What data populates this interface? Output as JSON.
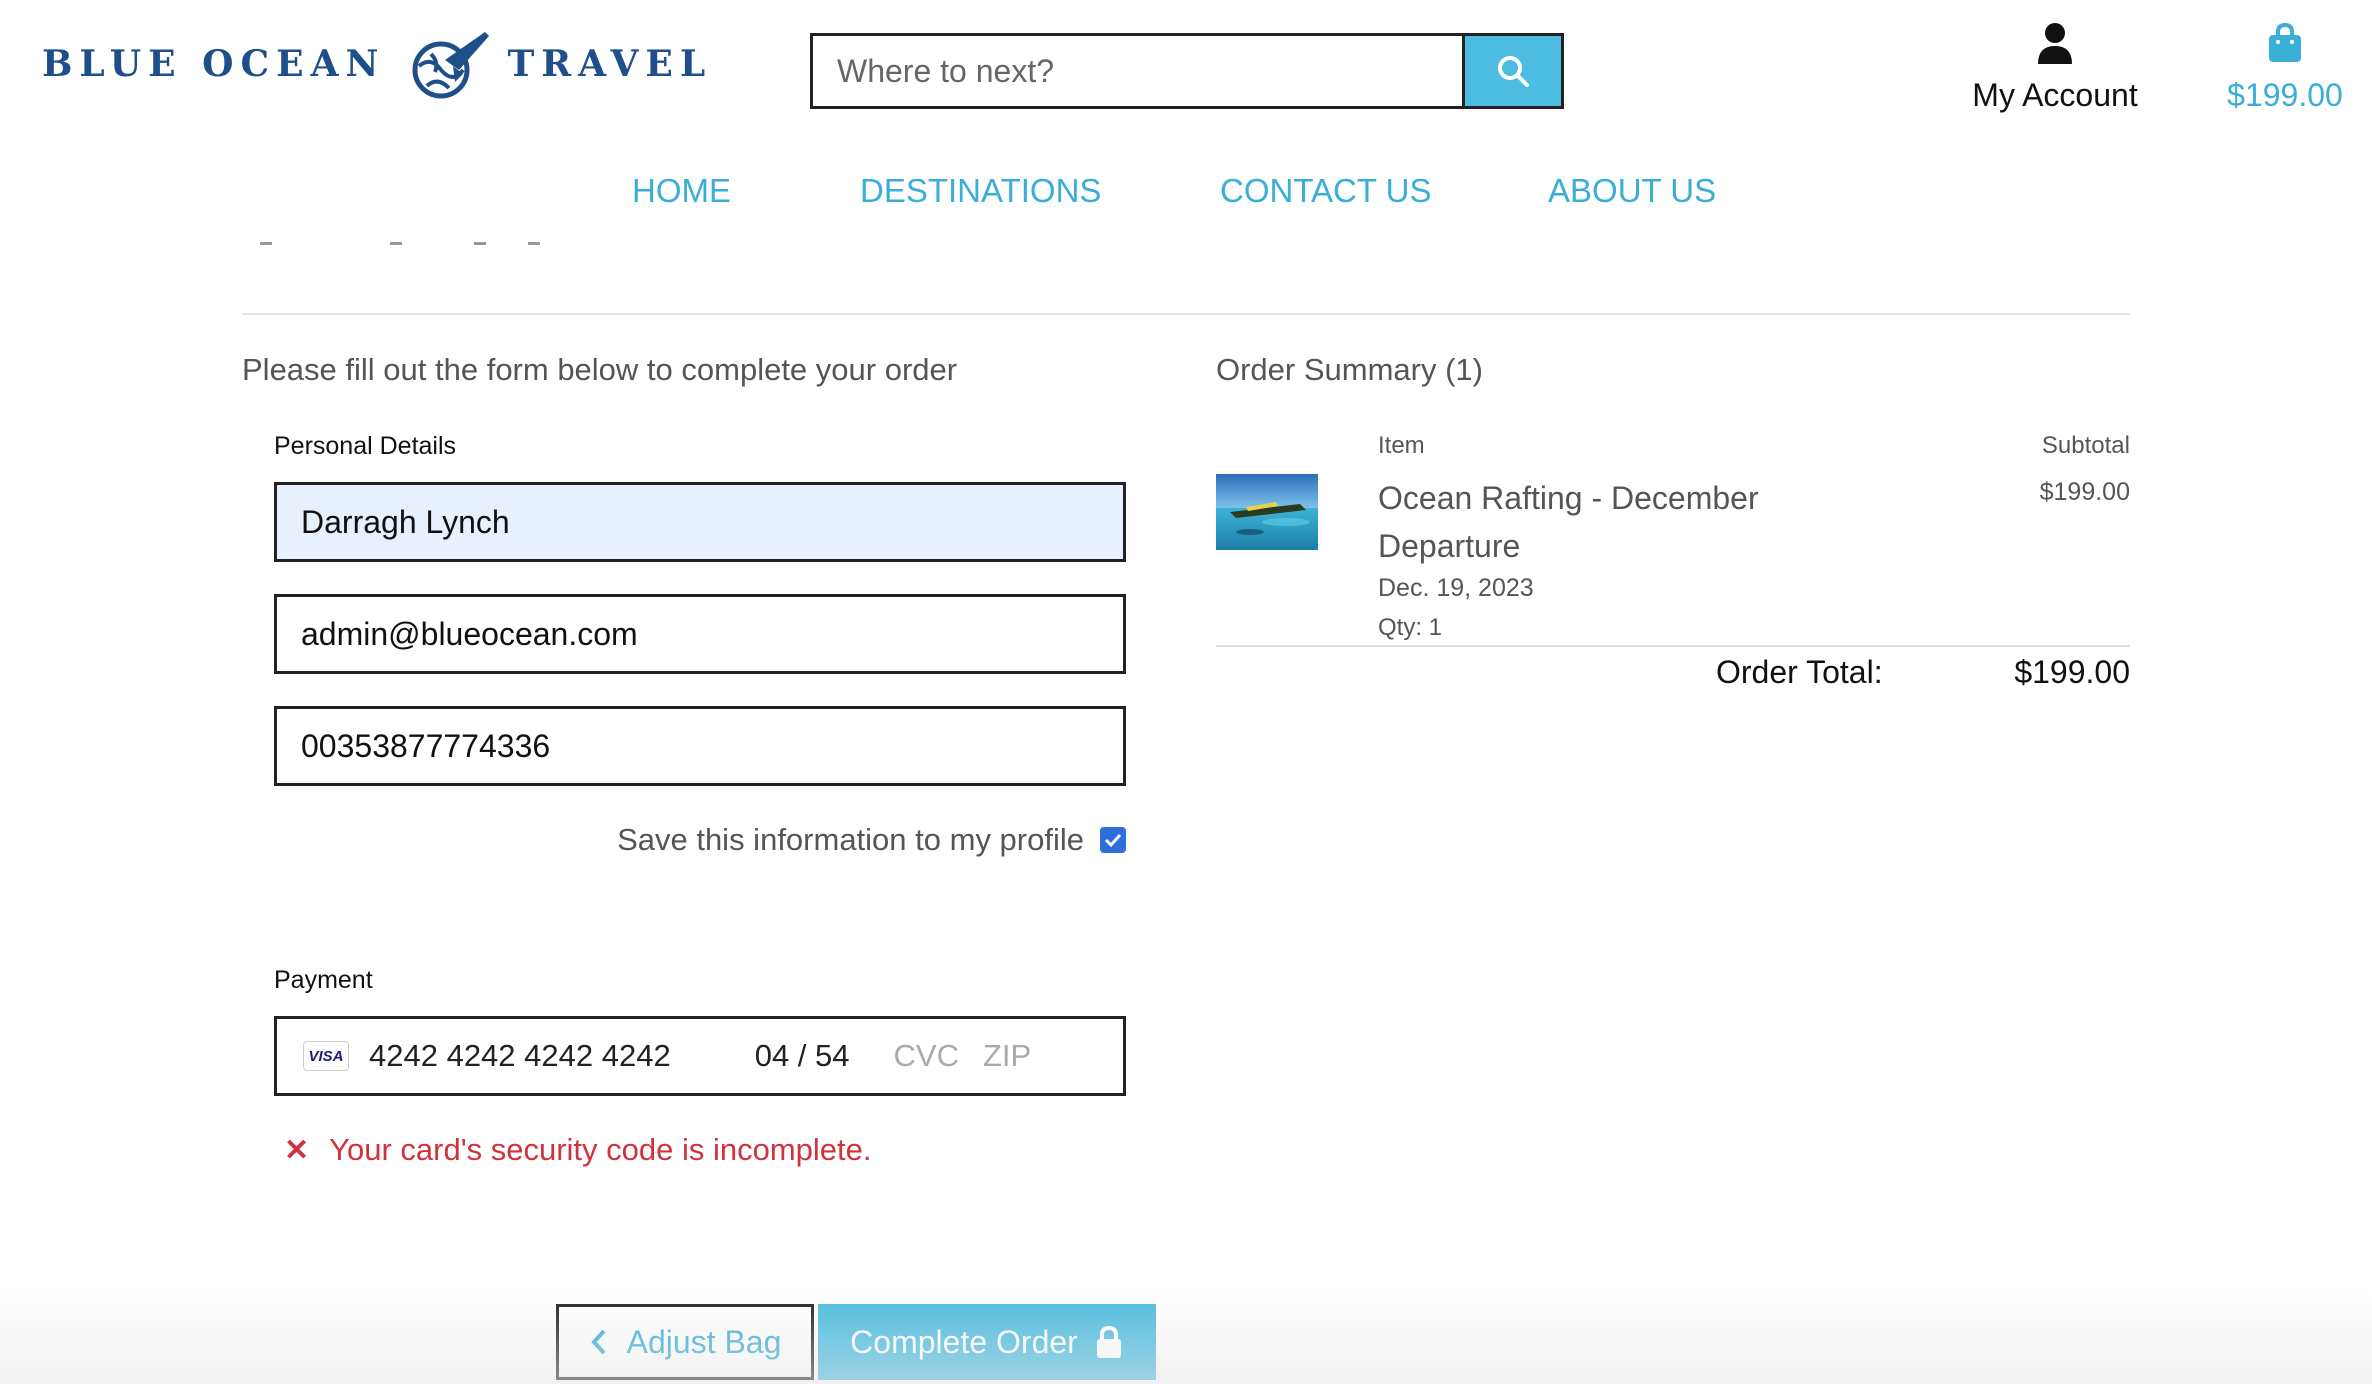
{
  "header": {
    "logo_left": "BLUE OCEAN",
    "logo_right": "TRAVEL",
    "search_placeholder": "Where to next?",
    "account_label": "My Account",
    "bag_total": "$199.00"
  },
  "nav": {
    "items": [
      "HOME",
      "DESTINATIONS",
      "CONTACT US",
      "ABOUT US"
    ]
  },
  "checkout": {
    "intro": "Please fill out the form below to complete your order",
    "personal_label": "Personal Details",
    "full_name": "Darragh Lynch",
    "email": "admin@blueocean.com",
    "phone": "00353877774336",
    "save_info_label": "Save this information to my profile",
    "save_info_checked": true,
    "payment_label": "Payment",
    "card_brand": "VISA",
    "card_number": "4242 4242 4242 4242",
    "card_expiry": "04 / 54",
    "card_cvc_placeholder": "CVC",
    "card_zip_placeholder": "ZIP",
    "error_message": "Your card's security code is incomplete.",
    "adjust_bag_label": "Adjust Bag",
    "complete_order_label": "Complete Order"
  },
  "summary": {
    "title": "Order Summary (1)",
    "item_header": "Item",
    "subtotal_header": "Subtotal",
    "item_name": "Ocean Rafting - December Departure",
    "item_date": "Dec. 19, 2023",
    "item_qty": "Qty: 1",
    "item_subtotal": "$199.00",
    "total_label": "Order Total:",
    "total_value": "$199.00"
  },
  "colors": {
    "brand_navy": "#1f4f8a",
    "accent_blue": "#4cbde0",
    "link_blue": "#3aaed6",
    "error_red": "#d0333c",
    "checkbox_blue": "#2f6fdc"
  },
  "icons": [
    "globe-plane-logo-icon",
    "search-icon",
    "user-icon",
    "shopping-bag-icon",
    "chevron-left-icon",
    "lock-icon",
    "close-x-icon"
  ]
}
